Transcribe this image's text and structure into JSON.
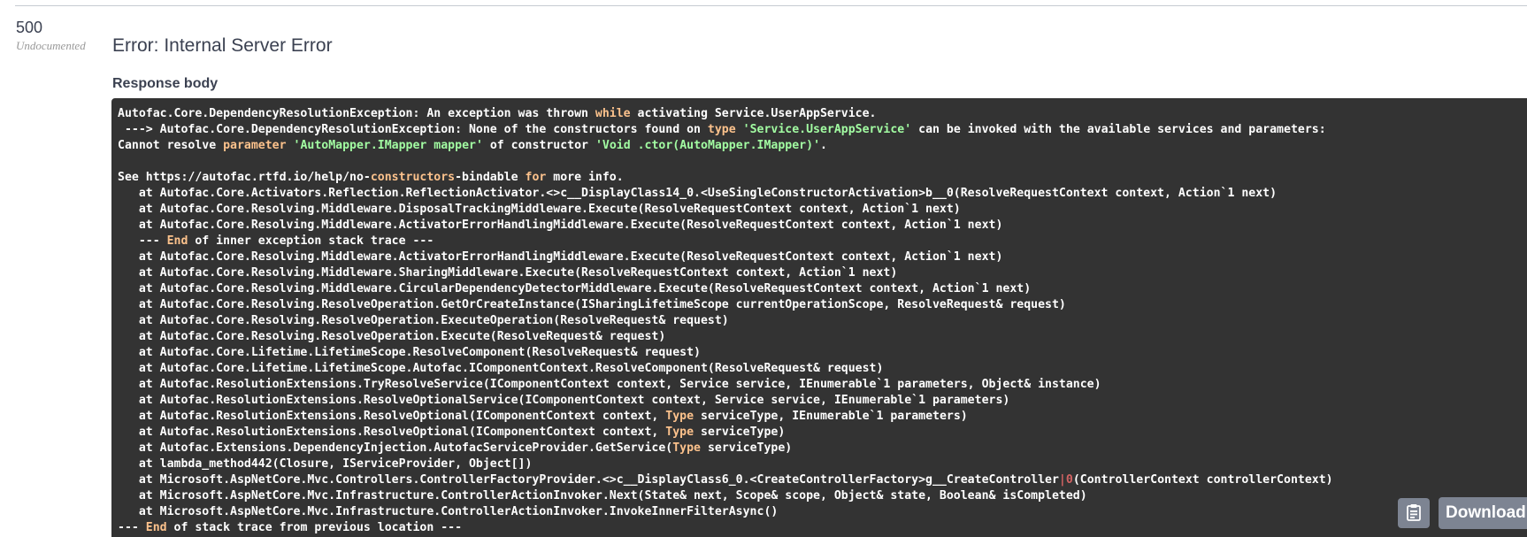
{
  "response": {
    "status_code": "500",
    "undocumented_label": "Undocumented",
    "error_title": "Error: Internal Server Error",
    "body_label": "Response body"
  },
  "code_lines": [
    [
      [
        "Autofac.Core.DependencyResolutionException: An exception was thrown ",
        ""
      ],
      [
        "while",
        "kw"
      ],
      [
        " activating Service.UserAppService.",
        ""
      ]
    ],
    [
      [
        " ---> Autofac.Core.DependencyResolutionException: None of the constructors found on ",
        ""
      ],
      [
        "type",
        "kw"
      ],
      [
        " ",
        ""
      ],
      [
        "'Service.UserAppService'",
        "str"
      ],
      [
        " can be invoked with the available services and parameters:",
        ""
      ]
    ],
    [
      [
        "Cannot resolve ",
        ""
      ],
      [
        "parameter",
        "kw"
      ],
      [
        " ",
        ""
      ],
      [
        "'AutoMapper.IMapper mapper'",
        "str"
      ],
      [
        " of constructor ",
        ""
      ],
      [
        "'Void .ctor(AutoMapper.IMapper)'",
        "str"
      ],
      [
        ".",
        ""
      ]
    ],
    [
      [
        "",
        ""
      ]
    ],
    [
      [
        "See https://autofac.rtfd.io/help/no-",
        ""
      ],
      [
        "constructors",
        "kw"
      ],
      [
        "-bindable ",
        ""
      ],
      [
        "for",
        "kw"
      ],
      [
        " more info.",
        ""
      ]
    ],
    [
      [
        "   at Autofac.Core.Activators.Reflection.ReflectionActivator.<>c__DisplayClass14_0.<UseSingleConstructorActivation>b__0(ResolveRequestContext context, Action`1 next)",
        ""
      ]
    ],
    [
      [
        "   at Autofac.Core.Resolving.Middleware.DisposalTrackingMiddleware.Execute(ResolveRequestContext context, Action`1 next)",
        ""
      ]
    ],
    [
      [
        "   at Autofac.Core.Resolving.Middleware.ActivatorErrorHandlingMiddleware.Execute(ResolveRequestContext context, Action`1 next)",
        ""
      ]
    ],
    [
      [
        "   --- ",
        ""
      ],
      [
        "End",
        "kw"
      ],
      [
        " of inner exception stack trace ---",
        ""
      ]
    ],
    [
      [
        "   at Autofac.Core.Resolving.Middleware.ActivatorErrorHandlingMiddleware.Execute(ResolveRequestContext context, Action`1 next)",
        ""
      ]
    ],
    [
      [
        "   at Autofac.Core.Resolving.Middleware.SharingMiddleware.Execute(ResolveRequestContext context, Action`1 next)",
        ""
      ]
    ],
    [
      [
        "   at Autofac.Core.Resolving.Middleware.CircularDependencyDetectorMiddleware.Execute(ResolveRequestContext context, Action`1 next)",
        ""
      ]
    ],
    [
      [
        "   at Autofac.Core.Resolving.ResolveOperation.GetOrCreateInstance(ISharingLifetimeScope currentOperationScope, ResolveRequest& request)",
        ""
      ]
    ],
    [
      [
        "   at Autofac.Core.Resolving.ResolveOperation.ExecuteOperation(ResolveRequest& request)",
        ""
      ]
    ],
    [
      [
        "   at Autofac.Core.Resolving.ResolveOperation.Execute(ResolveRequest& request)",
        ""
      ]
    ],
    [
      [
        "   at Autofac.Core.Lifetime.LifetimeScope.ResolveComponent(ResolveRequest& request)",
        ""
      ]
    ],
    [
      [
        "   at Autofac.Core.Lifetime.LifetimeScope.Autofac.IComponentContext.ResolveComponent(ResolveRequest& request)",
        ""
      ]
    ],
    [
      [
        "   at Autofac.ResolutionExtensions.TryResolveService(IComponentContext context, Service service, IEnumerable`1 parameters, Object& instance)",
        ""
      ]
    ],
    [
      [
        "   at Autofac.ResolutionExtensions.ResolveOptionalService(IComponentContext context, Service service, IEnumerable`1 parameters)",
        ""
      ]
    ],
    [
      [
        "   at Autofac.ResolutionExtensions.ResolveOptional(IComponentContext context, ",
        ""
      ],
      [
        "Type",
        "kw"
      ],
      [
        " serviceType, IEnumerable`1 parameters)",
        ""
      ]
    ],
    [
      [
        "   at Autofac.ResolutionExtensions.ResolveOptional(IComponentContext context, ",
        ""
      ],
      [
        "Type",
        "kw"
      ],
      [
        " serviceType)",
        ""
      ]
    ],
    [
      [
        "   at Autofac.Extensions.DependencyInjection.AutofacServiceProvider.GetService(",
        ""
      ],
      [
        "Type",
        "kw"
      ],
      [
        " serviceType)",
        ""
      ]
    ],
    [
      [
        "   at lambda_method442(Closure, IServiceProvider, Object[])",
        ""
      ]
    ],
    [
      [
        "   at Microsoft.AspNetCore.Mvc.Controllers.ControllerFactoryProvider.<>c__DisplayClass6_0.<CreateControllerFactory>g__CreateController",
        ""
      ],
      [
        "|",
        "sep"
      ],
      [
        "0",
        "num"
      ],
      [
        "(ControllerContext controllerContext)",
        ""
      ]
    ],
    [
      [
        "   at Microsoft.AspNetCore.Mvc.Infrastructure.ControllerActionInvoker.Next(State& next, Scope& scope, Object& state, Boolean& isCompleted)",
        ""
      ]
    ],
    [
      [
        "   at Microsoft.AspNetCore.Mvc.Infrastructure.ControllerActionInvoker.InvokeInnerFilterAsync()",
        ""
      ]
    ],
    [
      [
        "--- ",
        ""
      ],
      [
        "End",
        "kw"
      ],
      [
        " of stack trace from previous location ---",
        ""
      ]
    ]
  ],
  "actions": {
    "copy_icon": "clipboard-icon",
    "download_label": "Download"
  }
}
